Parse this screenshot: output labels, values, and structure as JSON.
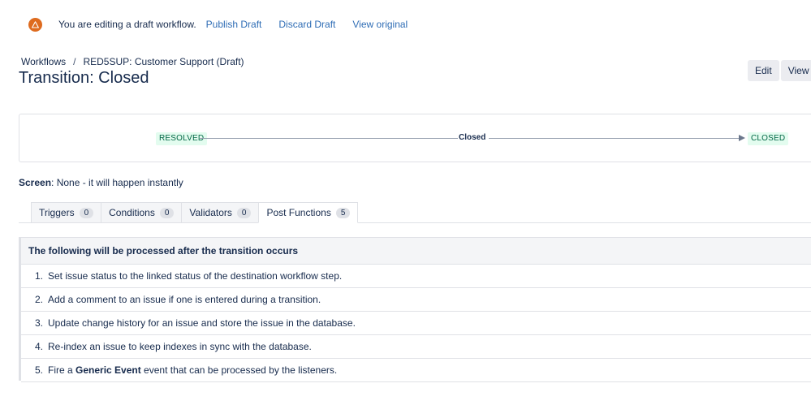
{
  "draft_banner": {
    "message": "You are editing a draft workflow.",
    "publish_label": "Publish Draft",
    "discard_label": "Discard Draft",
    "view_original_label": "View original"
  },
  "breadcrumb": {
    "root": "Workflows",
    "separator": "/",
    "current": "RED5SUP: Customer Support (Draft)"
  },
  "page_title": "Transition: Closed",
  "header_actions": {
    "edit_label": "Edit",
    "view_label": "View P"
  },
  "diagram": {
    "from_status": "RESOLVED",
    "transition_name": "Closed",
    "to_status": "CLOSED"
  },
  "screen": {
    "label": "Screen",
    "value": ": None - it will happen instantly"
  },
  "tabs": [
    {
      "label": "Triggers",
      "count": "0",
      "active": false
    },
    {
      "label": "Conditions",
      "count": "0",
      "active": false
    },
    {
      "label": "Validators",
      "count": "0",
      "active": false
    },
    {
      "label": "Post Functions",
      "count": "5",
      "active": true
    }
  ],
  "post_functions": {
    "header": "The following will be processed after the transition occurs",
    "items": [
      {
        "num": "1.",
        "text": "Set issue status to the linked status of the destination workflow step."
      },
      {
        "num": "2.",
        "text": "Add a comment to an issue if one is entered during a transition."
      },
      {
        "num": "3.",
        "text": "Update change history for an issue and store the issue in the database."
      },
      {
        "num": "4.",
        "text": "Re-index an issue to keep indexes in sync with the database."
      },
      {
        "num": "5.",
        "text_before": "Fire a ",
        "bold": "Generic Event",
        "text_after": " event that can be processed by the listeners."
      }
    ]
  },
  "colors": {
    "link": "#2f6db5",
    "warning": "#de6b1f",
    "status_bg": "#e3fcef",
    "status_text": "#006644",
    "text": "#172b4d"
  },
  "icons": {
    "warning": "warning-icon"
  }
}
